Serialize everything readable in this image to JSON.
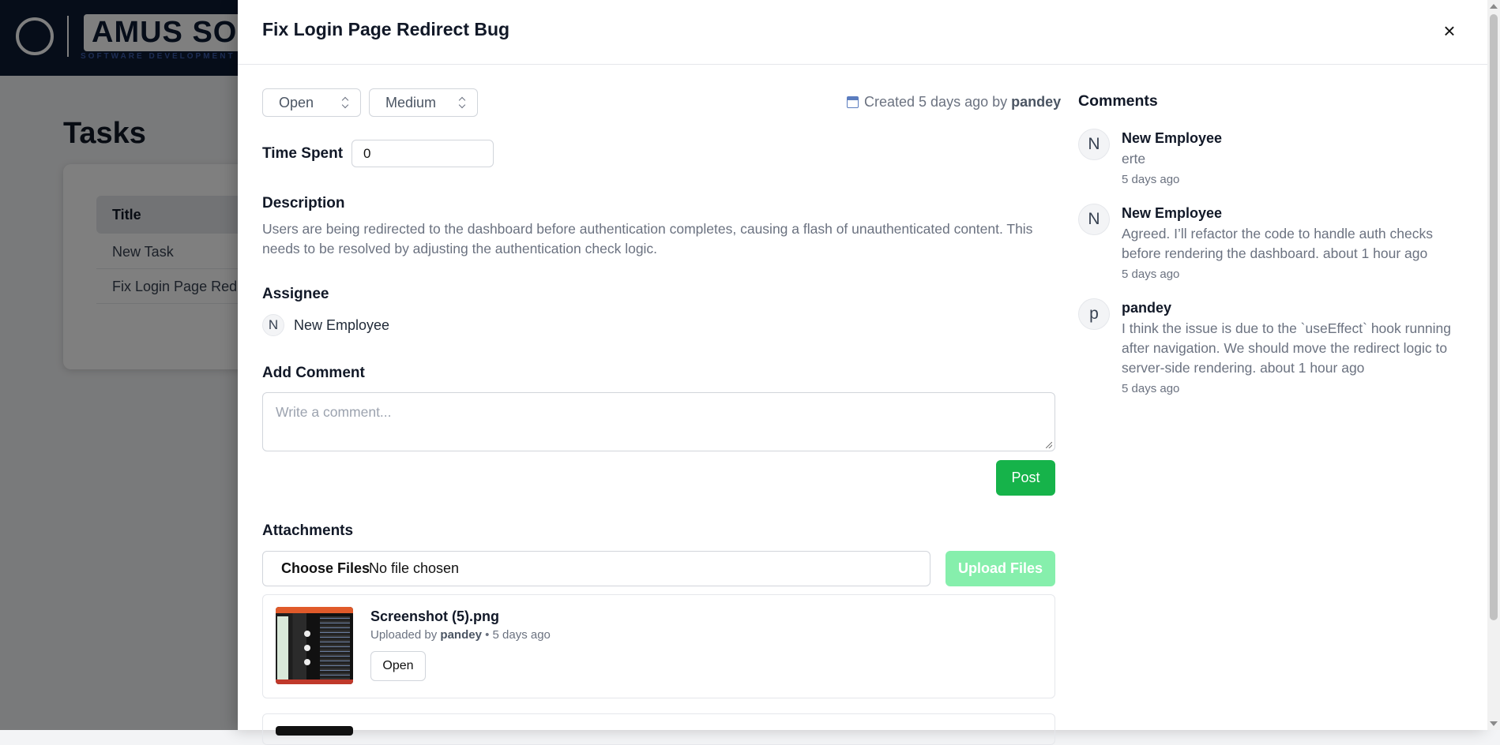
{
  "background": {
    "brand": "AMUS SO",
    "brand_sub": "SOFTWARE DEVELOPMENT & CO",
    "page_title": "Tasks",
    "table_header": "Title",
    "rows": [
      "New Task",
      "Fix Login Page Redire"
    ]
  },
  "drawer": {
    "title": "Fix Login Page Redirect Bug",
    "close": "×",
    "status": "Open",
    "priority": "Medium",
    "created_text": "Created 5 days ago by",
    "created_by": "pandey",
    "time_spent_label": "Time Spent",
    "time_spent_value": "0",
    "description_label": "Description",
    "description": "Users are being redirected to the dashboard before authentication completes, causing a flash of unauthenticated content. This needs to be resolved by adjusting the authentication check logic.",
    "assignee_label": "Assignee",
    "assignee_initial": "N",
    "assignee_name": "New Employee",
    "add_comment_label": "Add Comment",
    "comment_placeholder": "Write a comment...",
    "post_label": "Post",
    "attachments_label": "Attachments",
    "choose_files": "Choose Files",
    "no_file": "No file chosen",
    "upload_label": "Upload Files",
    "attachments": [
      {
        "name": "Screenshot (5).png",
        "meta_prefix": "Uploaded by",
        "uploader": "pandey",
        "meta_suffix": "• 5 days ago",
        "open_label": "Open"
      }
    ]
  },
  "comments": {
    "title": "Comments",
    "items": [
      {
        "initial": "N",
        "author": "New Employee",
        "text": "erte",
        "time": "5 days ago"
      },
      {
        "initial": "N",
        "author": "New Employee",
        "text": "Agreed. I’ll refactor the code to handle auth checks before rendering the dashboard. about 1 hour ago",
        "time": "5 days ago"
      },
      {
        "initial": "p",
        "author": "pandey",
        "text": "I think the issue is due to the `useEffect` hook running after navigation. We should move the redirect logic to server-side rendering. about 1 hour ago",
        "time": "5 days ago"
      }
    ]
  },
  "colors": {
    "accent_green": "#16b34a",
    "disabled_green": "#86efac",
    "header_navy": "#0d1b33"
  }
}
